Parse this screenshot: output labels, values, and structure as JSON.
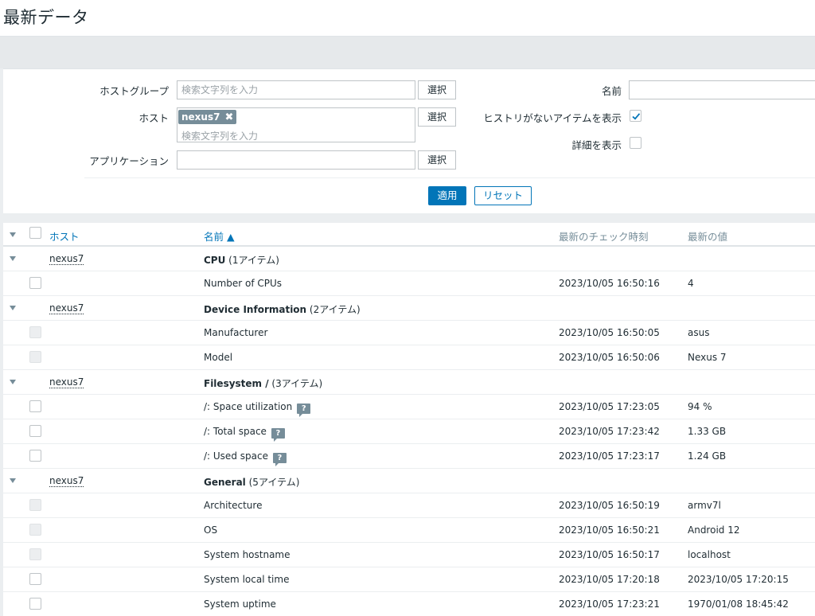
{
  "page": {
    "title": "最新データ"
  },
  "filter": {
    "host_group_label": "ホストグループ",
    "host_group_placeholder": "検索文字列を入力",
    "host_label": "ホスト",
    "host_tag": "nexus7",
    "host_placeholder": "検索文字列を入力",
    "application_label": "アプリケーション",
    "select_label": "選択",
    "name_label": "名前",
    "show_no_history_label": "ヒストリがないアイテムを表示",
    "show_no_history_checked": true,
    "show_details_label": "詳細を表示",
    "show_details_checked": false,
    "apply_label": "適用",
    "reset_label": "リセット"
  },
  "table": {
    "headers": {
      "host": "ホスト",
      "name": "名前 ▲",
      "last_check": "最新のチェック時刻",
      "last_value": "最新の値"
    },
    "groups": [
      {
        "host": "nexus7",
        "app": "CPU",
        "count": " (1アイテム)",
        "items": [
          {
            "name": "Number of CPUs",
            "time": "2023/10/05 16:50:16",
            "value": "4"
          }
        ]
      },
      {
        "host": "nexus7",
        "app": "Device Information",
        "count": " (2アイテム)",
        "items": [
          {
            "name": "Manufacturer",
            "time": "2023/10/05 16:50:05",
            "value": "asus"
          },
          {
            "name": "Model",
            "time": "2023/10/05 16:50:06",
            "value": "Nexus 7"
          }
        ]
      },
      {
        "host": "nexus7",
        "app": "Filesystem /",
        "count": " (3アイテム)",
        "items": [
          {
            "name": "/: Space utilization",
            "time": "2023/10/05 17:23:05",
            "value": "94 %"
          },
          {
            "name": "/: Total space",
            "time": "2023/10/05 17:23:42",
            "value": "1.33 GB"
          },
          {
            "name": "/: Used space",
            "time": "2023/10/05 17:23:17",
            "value": "1.24 GB"
          }
        ]
      },
      {
        "host": "nexus7",
        "app": "General",
        "count": " (5アイテム)",
        "items": [
          {
            "name": "Architecture",
            "time": "2023/10/05 16:50:19",
            "value": "armv7l"
          },
          {
            "name": "OS",
            "time": "2023/10/05 16:50:21",
            "value": "Android 12"
          },
          {
            "name": "System hostname",
            "time": "2023/10/05 16:50:17",
            "value": "localhost"
          },
          {
            "name": "System local time",
            "time": "2023/10/05 17:20:18",
            "value": "2023/10/05 17:20:15"
          },
          {
            "name": "System uptime",
            "time": "2023/10/05 17:23:21",
            "value": "1970/01/08 18:45:42"
          }
        ]
      }
    ],
    "hint_glyph": "?",
    "colors": {
      "link": "#0275b8",
      "muted": "#768d99",
      "primary_button": "#0275b8"
    }
  }
}
